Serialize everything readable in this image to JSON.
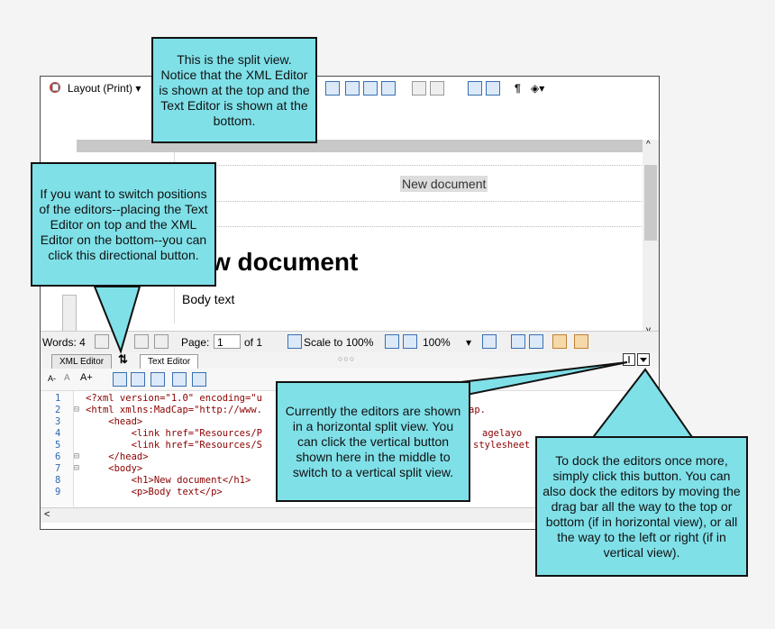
{
  "toolbar": {
    "layout_label": "Layout (Print)",
    "dropdown_arrow": "▾"
  },
  "document": {
    "header_text": "New document",
    "heading": "w document",
    "body": "Body text"
  },
  "statusbar": {
    "words": "Words: 4",
    "page_label": "Page:",
    "page_value": "1",
    "of_label": "of 1",
    "scale_label": "Scale to 100%",
    "zoom": "100%"
  },
  "tabs": [
    {
      "label": "XML Editor"
    },
    {
      "label": "Text Editor"
    }
  ],
  "tabs_swap_glyph": "⇅",
  "dots": "○○○",
  "code": {
    "line_numbers": [
      "1",
      "2",
      "3",
      "4",
      "5",
      "6",
      "7",
      "8",
      "9"
    ],
    "lines": [
      "<?xml version=\"1.0\" encoding=\"u",
      "<html xmlns:MadCap=\"http://www.",
      "    <head>",
      "        <link href=\"Resources/P",
      "        <link href=\"Resources/S",
      "    </head>",
      "    <body>",
      "        <h1>New document</h1>",
      "        <p>Body text</p>"
    ],
    "right_fragments": [
      "ap.",
      "agelayo",
      "stylesheet"
    ]
  },
  "callouts": {
    "split_view": "This is the split view. Notice that the XML Editor is shown at the top and the Text Editor is shown at the bottom.",
    "switch_positions": "If you want to switch positions of the editors--placing the Text Editor on top and the XML Editor on the bottom--you can click this directional button.",
    "horizontal_split": "Currently the editors are shown in a horizontal split view. You can click the vertical button shown here in the middle to switch to a vertical split view.",
    "dock": "To dock the editors once more, simply click this button. You can also dock the editors by moving the drag bar all the way to the top or bottom (if in horizontal view), or all the way to the left or right (if in vertical view)."
  },
  "colors": {
    "callout_fill": "#7fe0e8",
    "callout_border": "#111111",
    "line_number": "#2b6ab0",
    "code_text": "#8b0000"
  }
}
